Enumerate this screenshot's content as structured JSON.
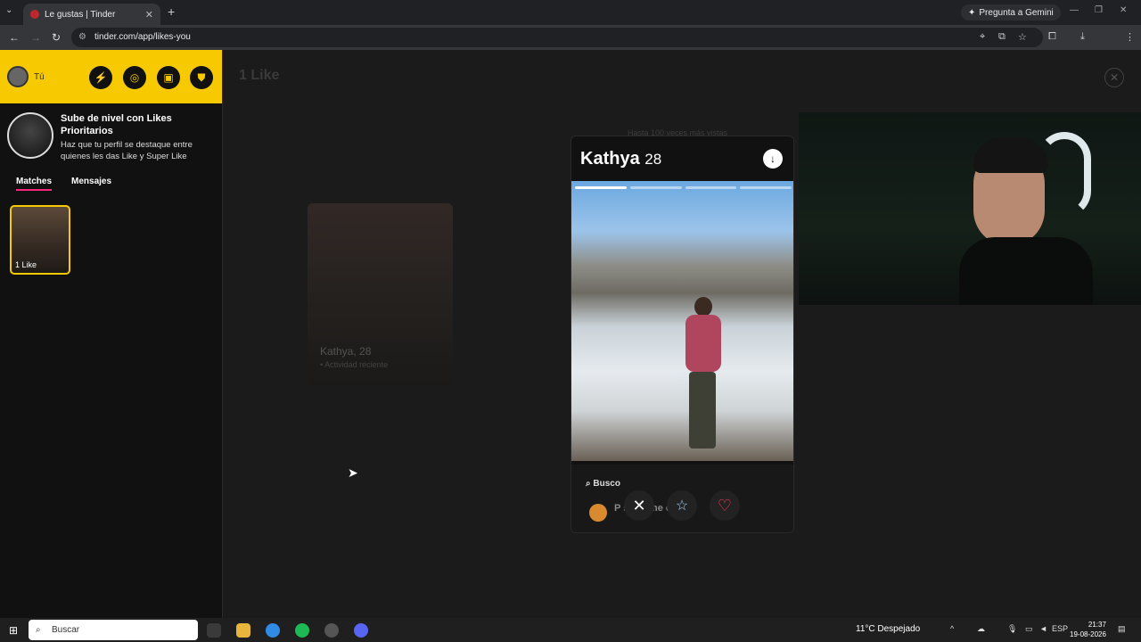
{
  "browser": {
    "tab_title": "Le gustas | Tinder",
    "url": "tinder.com/app/likes-you",
    "gemini_label": "Pregunta a Gemini"
  },
  "sidebar": {
    "user_label": "Tú",
    "promo_title": "Sube de nivel con Likes Prioritarios",
    "promo_subtitle": "Haz que tu perfil se destaque entre quienes les das Like y Super Like",
    "tabs": [
      "Matches",
      "Mensajes"
    ],
    "match_label": "1 Like"
  },
  "main": {
    "title": "1 Like",
    "blurred_card_name": "Kathya, 28",
    "blurred_card_activity": "• Actividad reciente"
  },
  "profile": {
    "hint": "Hasta 100 veces más vistas",
    "name": "Kathya",
    "age": "28",
    "looking_for_label": "Busco",
    "looking_for_text": "P     st     pe     me ciert"
  },
  "taskbar": {
    "search_placeholder": "Buscar",
    "weather": "11°C  Despejado",
    "lang": "ESP",
    "time": "21:37",
    "date": "19-08-2026"
  },
  "colors": {
    "tinder_yellow": "#f7c900",
    "tinder_pink": "#fd267a",
    "heart_red": "#fd3a5a"
  }
}
